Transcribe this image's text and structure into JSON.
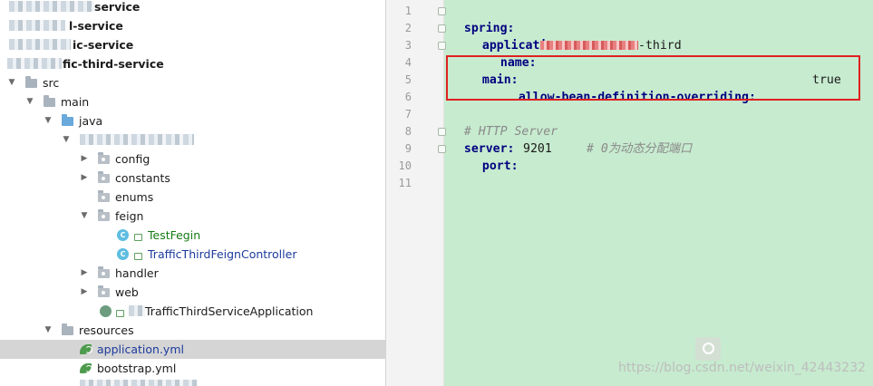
{
  "project_tree": {
    "rows": [
      {
        "label": "service",
        "style": "bold"
      },
      {
        "label": "l-service",
        "style": "bold"
      },
      {
        "label": "ic-service",
        "style": "bold"
      },
      {
        "label": "fic-third-service",
        "style": "bold"
      },
      {
        "label": "src",
        "icon": "folder-icon"
      },
      {
        "label": "main",
        "icon": "folder-icon"
      },
      {
        "label": "java",
        "icon": "source-folder-icon"
      },
      {
        "label": "",
        "icon": "package-icon"
      },
      {
        "label": "config",
        "icon": "package-icon"
      },
      {
        "label": "constants",
        "icon": "package-icon"
      },
      {
        "label": "enums",
        "icon": "package-icon"
      },
      {
        "label": "feign",
        "icon": "package-icon"
      },
      {
        "label": "TestFegin",
        "icon": "class-icon"
      },
      {
        "label": "TrafficThirdFeignController",
        "icon": "class-icon"
      },
      {
        "label": "handler",
        "icon": "package-icon"
      },
      {
        "label": "web",
        "icon": "package-icon"
      },
      {
        "label": "TrafficThirdServiceApplication",
        "icon": "spring-boot-app-icon"
      },
      {
        "label": "resources",
        "icon": "resources-folder-icon"
      },
      {
        "label": "application.yml",
        "icon": "spring-yml-icon"
      },
      {
        "label": "bootstrap.yml",
        "icon": "spring-yml-icon"
      }
    ],
    "selected": "application.yml"
  },
  "editor": {
    "line_numbers": [
      "1",
      "2",
      "3",
      "4",
      "5",
      "6",
      "7",
      "8",
      "9",
      "10",
      "11"
    ],
    "lines": {
      "l1_key": "spring:",
      "l2_key": "application:",
      "l3_key": "name:",
      "l3_value": "-third",
      "l4_key": "main:",
      "l5_key": "allow-bean-definition-overriding:",
      "l5_value": "true",
      "l7_comment": "# HTTP Server",
      "l8_key": "server:",
      "l9_key": "port:",
      "l9_value": "9201",
      "l9_comment": "# 0为动态分配端口"
    }
  },
  "watermark": "https://blog.csdn.net/weixin_42443232",
  "colors": {
    "highlight_box": "#e02020",
    "editor_background": "#c7ebcf",
    "selection": "#d5d5d5"
  }
}
